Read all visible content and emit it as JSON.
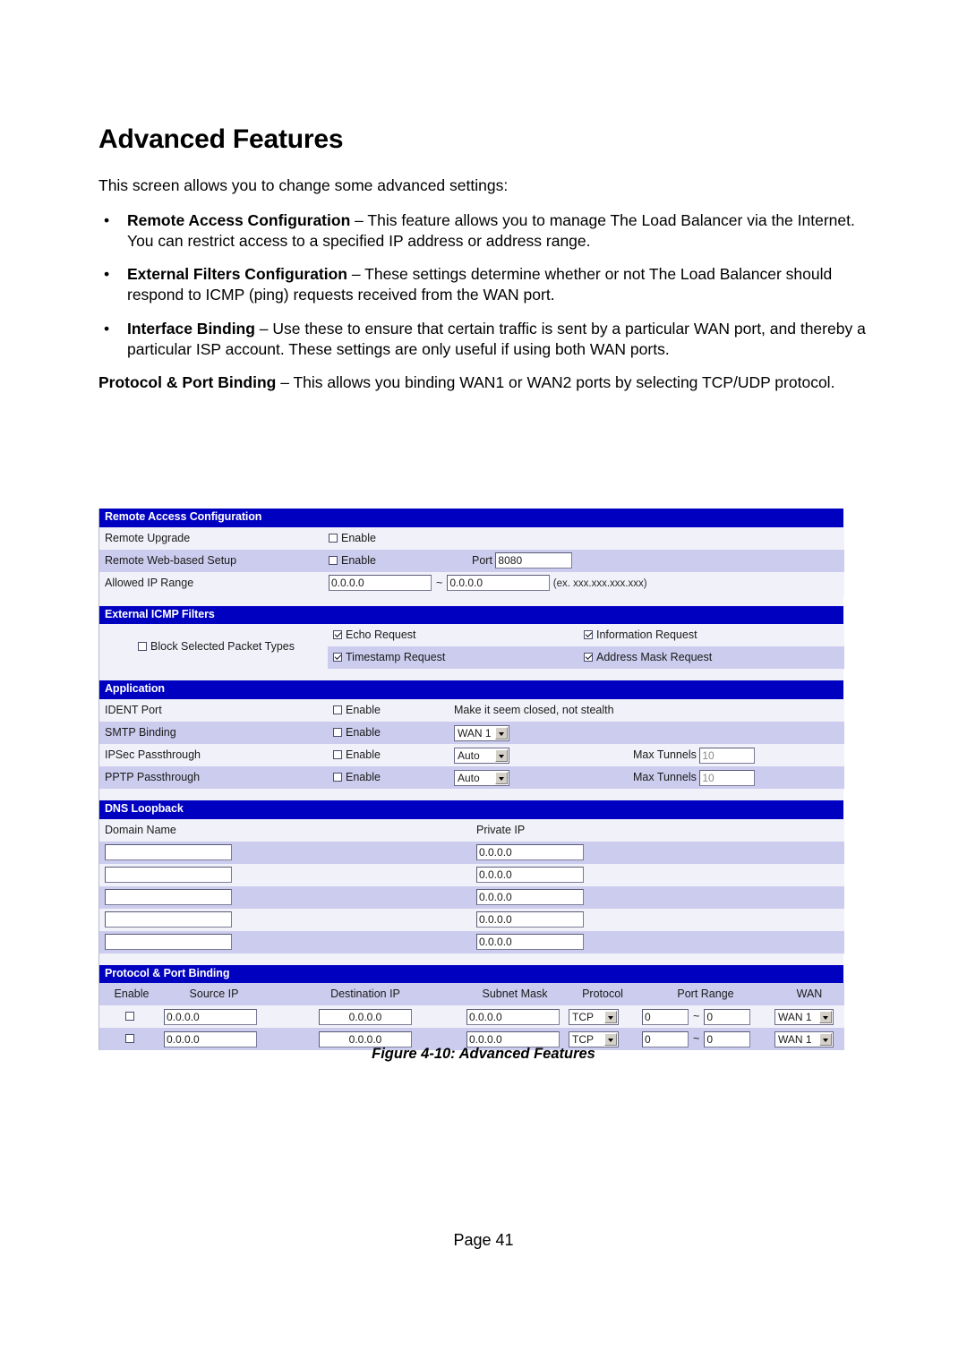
{
  "document": {
    "title": "Advanced Features",
    "intro": "This screen allows you to change some advanced settings:",
    "bullets": [
      {
        "term": "Remote Access Configuration",
        "text": " – This feature allows you to manage The Load Balancer via the Internet. You can restrict access to a specified IP address or address range."
      },
      {
        "term": "External Filters Configuration",
        "text": " – These settings determine whether or not The Load Balancer should respond to ICMP (ping) requests received from the WAN port."
      },
      {
        "term": "Interface Binding",
        "text": " – Use these to ensure that certain traffic is sent by a particular WAN port, and thereby a particular ISP account. These settings are only useful if using both WAN ports."
      }
    ],
    "trailing": {
      "term": "Protocol & Port Binding",
      "text": "  – This allows you binding WAN1 or WAN2 ports by selecting TCP/UDP protocol."
    },
    "figure_caption": "Figure 4-10: Advanced Features",
    "page_footer": "Page 41"
  },
  "colors": {
    "section_header_bg": "#0000c0",
    "section_header_fg": "#ffffff",
    "row_light": "#f1f1f9",
    "row_dark": "#ccccee",
    "input_border": "#7b7b99"
  },
  "ui": {
    "remote_access": {
      "header": "Remote Access Configuration",
      "rows": [
        {
          "label": "Remote Upgrade",
          "enable_label": "Enable",
          "enable_checked": false
        },
        {
          "label": "Remote Web-based Setup",
          "enable_label": "Enable",
          "enable_checked": false,
          "port_label": "Port",
          "port_value": "8080"
        },
        {
          "label": "Allowed IP Range",
          "from_value": "0.0.0.0",
          "separator": "~",
          "to_value": "0.0.0.0",
          "hint": "(ex. xxx.xxx.xxx.xxx)"
        }
      ]
    },
    "icmp_filters": {
      "header": "External ICMP Filters",
      "block_label": "Block Selected Packet Types",
      "block_checked": false,
      "types": [
        {
          "label": "Echo Request",
          "checked": true
        },
        {
          "label": "Information Request",
          "checked": true
        },
        {
          "label": "Timestamp Request",
          "checked": true
        },
        {
          "label": "Address Mask Request",
          "checked": true
        }
      ]
    },
    "application": {
      "header": "Application",
      "rows": [
        {
          "label": "IDENT Port",
          "enable_label": "Enable",
          "enable_checked": false,
          "note": "Make it seem closed, not stealth"
        },
        {
          "label": "SMTP Binding",
          "enable_label": "Enable",
          "enable_checked": false,
          "select_value": "WAN 1"
        },
        {
          "label": "IPSec Passthrough",
          "enable_label": "Enable",
          "enable_checked": false,
          "select_value": "Auto",
          "tunnels_label": "Max Tunnels",
          "tunnels_value": "10"
        },
        {
          "label": "PPTP Passthrough",
          "enable_label": "Enable",
          "enable_checked": false,
          "select_value": "Auto",
          "tunnels_label": "Max Tunnels",
          "tunnels_value": "10"
        }
      ]
    },
    "dns_loopback": {
      "header": "DNS Loopback",
      "col_domain": "Domain Name",
      "col_private_ip": "Private IP",
      "rows": [
        {
          "domain": "",
          "private_ip": "0.0.0.0"
        },
        {
          "domain": "",
          "private_ip": "0.0.0.0"
        },
        {
          "domain": "",
          "private_ip": "0.0.0.0"
        },
        {
          "domain": "",
          "private_ip": "0.0.0.0"
        },
        {
          "domain": "",
          "private_ip": "0.0.0.0"
        }
      ]
    },
    "port_binding": {
      "header": "Protocol & Port Binding",
      "columns": [
        "Enable",
        "Source IP",
        "Destination IP",
        "Subnet Mask",
        "Protocol",
        "Port Range",
        "WAN"
      ],
      "rows": [
        {
          "enable_checked": false,
          "source_ip": "0.0.0.0",
          "destination_ip": "0.0.0.0",
          "subnet_mask": "0.0.0.0",
          "protocol": "TCP",
          "port_from": "0",
          "port_sep": "~",
          "port_to": "0",
          "wan": "WAN 1"
        },
        {
          "enable_checked": false,
          "source_ip": "0.0.0.0",
          "destination_ip": "0.0.0.0",
          "subnet_mask": "0.0.0.0",
          "protocol": "TCP",
          "port_from": "0",
          "port_sep": "~",
          "port_to": "0",
          "wan": "WAN 1"
        }
      ]
    }
  }
}
